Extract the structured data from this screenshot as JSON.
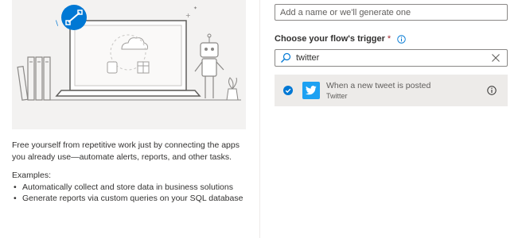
{
  "left": {
    "intro": "Free yourself from repetitive work just by connecting the apps you already use—automate alerts, reports, and other tasks.",
    "examples_label": "Examples:",
    "examples": [
      "Automatically collect and store data in business solutions",
      "Generate reports via custom queries on your SQL database"
    ]
  },
  "form": {
    "name_placeholder": "Add a name or we'll generate one",
    "trigger_label": "Choose your flow's trigger",
    "required_mark": "*",
    "search_value": "twitter"
  },
  "trigger": {
    "name": "When a new tweet is posted",
    "connector": "Twitter",
    "selected": true
  },
  "colors": {
    "accent": "#0078d4",
    "twitter": "#1da1f2",
    "selected_row": "#edebe9",
    "illustration_bg": "#f3f2f1"
  },
  "icons": [
    "flow-icon",
    "info-icon",
    "search-icon",
    "clear-icon",
    "check-circle-icon",
    "twitter-bird-icon",
    "details-info-icon"
  ]
}
